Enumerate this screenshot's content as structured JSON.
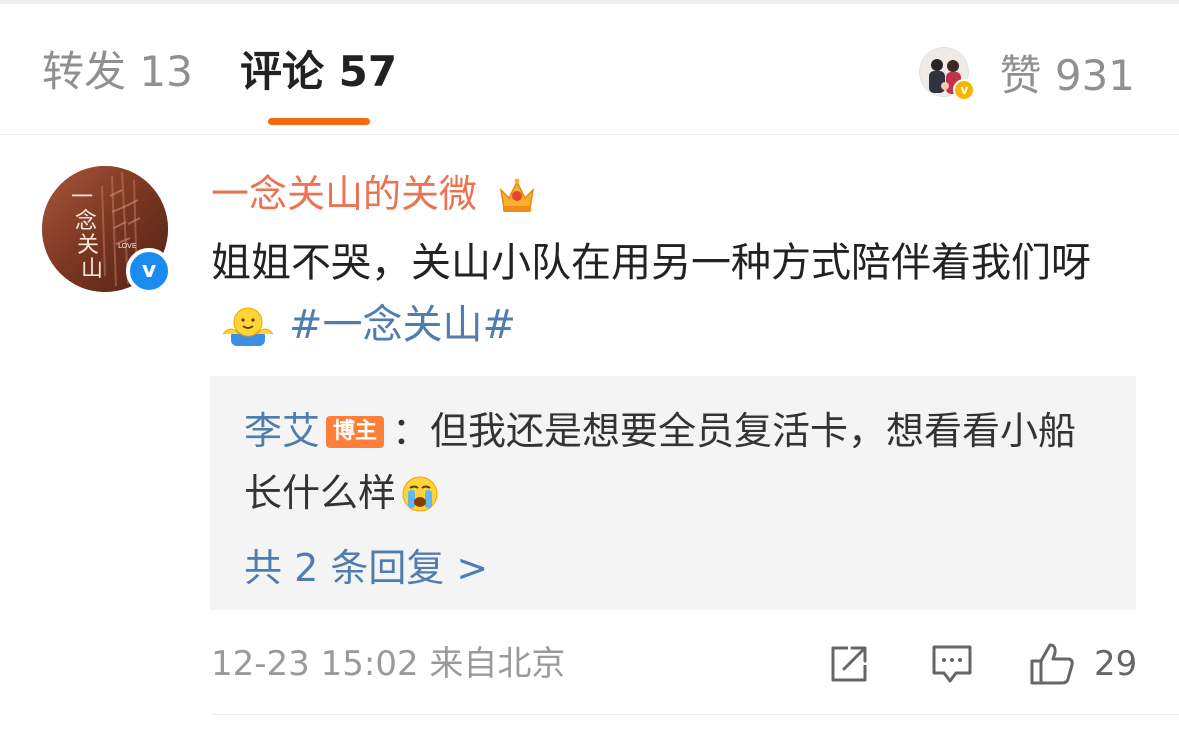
{
  "tabs": {
    "repost_label": "转发 13",
    "comments_label": "评论 57",
    "likes_label": "赞 931",
    "active_color": "#f06b12"
  },
  "comment": {
    "username": "一念关山的关微",
    "username_color": "#eb7350",
    "text": "姐姐不哭，关山小队在用另一种方式陪伴着我们呀",
    "emoji": "hug-emoji",
    "hashtag": "#一念关山#",
    "avatar_text": "一念关山",
    "avatar_sub": "LOVE",
    "verified_color": "#1a8cf0"
  },
  "reply": {
    "author": "李艾",
    "badge": "博主",
    "separator": "：",
    "text": "但我还是想要全员复活卡，想看看小船长什么样",
    "emoji": "crying-emoji",
    "more_label": "共 2 条回复 >"
  },
  "meta": {
    "time": "12-23 15:02",
    "source": "来自北京",
    "like_count": "29",
    "link_color": "#507daf"
  }
}
